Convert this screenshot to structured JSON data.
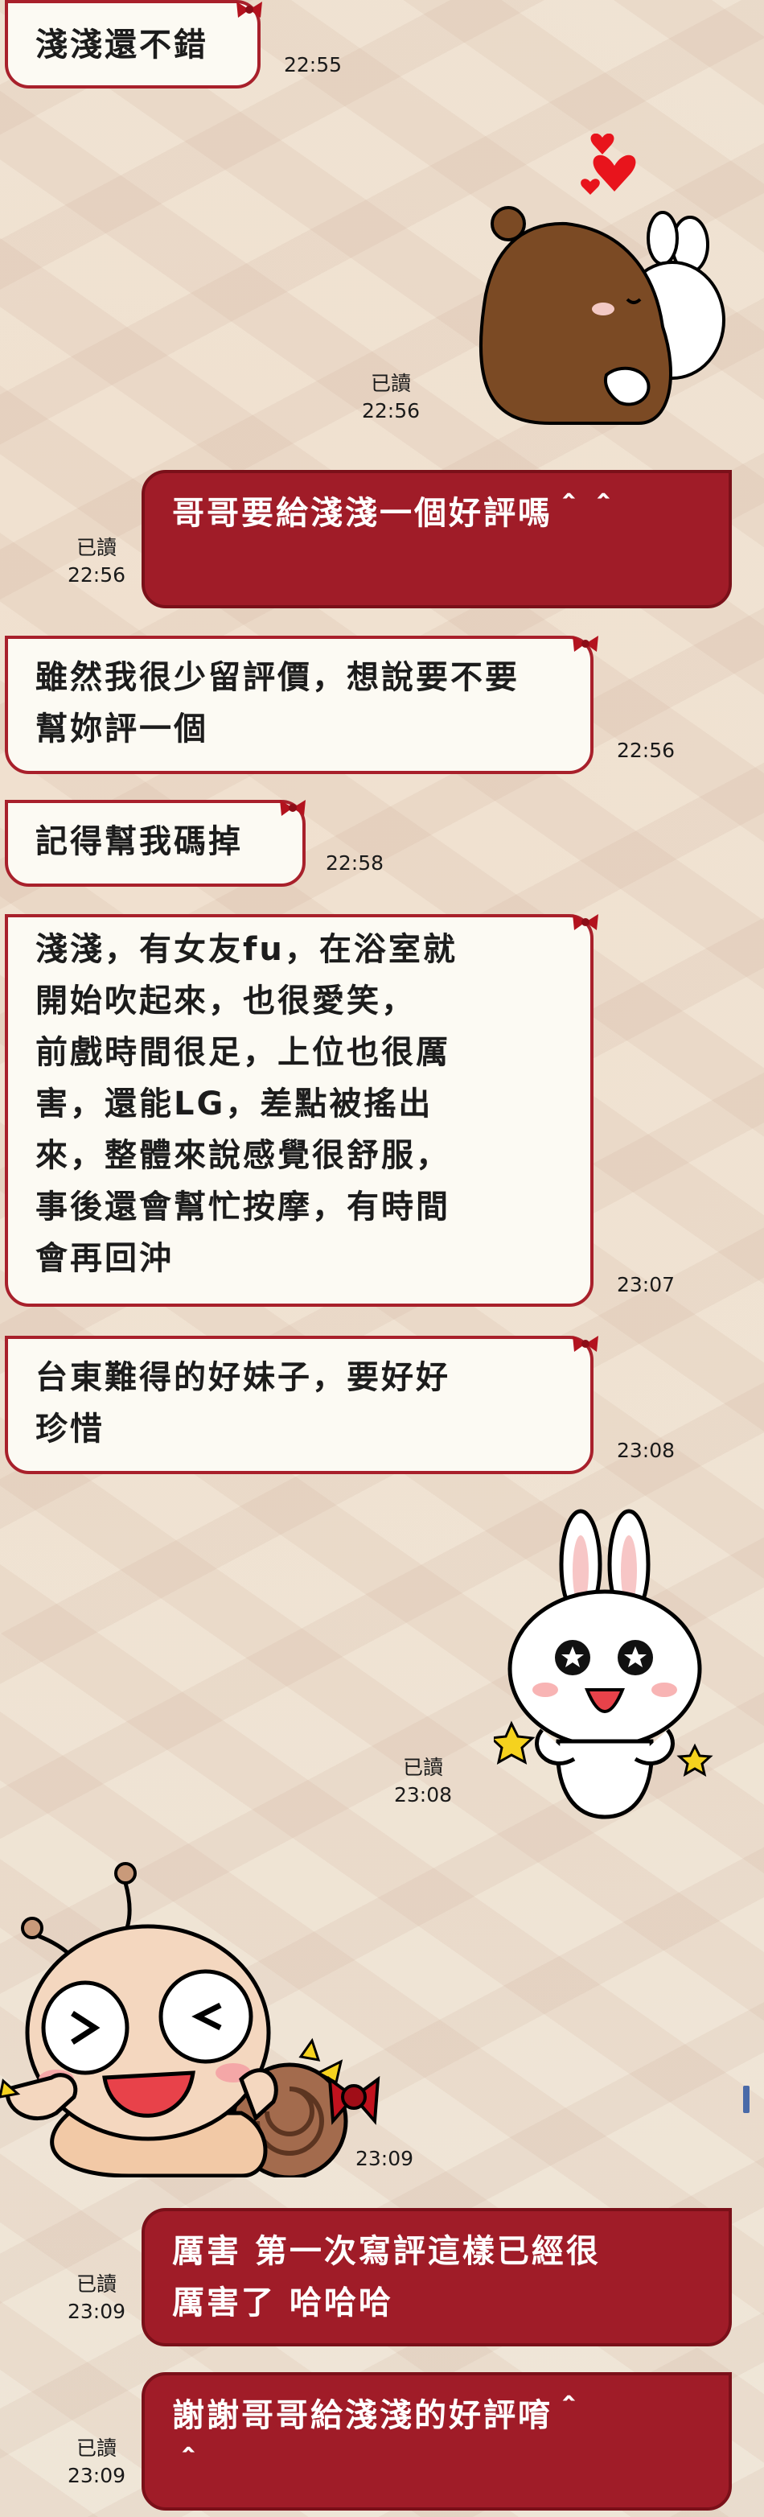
{
  "messages": [
    {
      "text": "淺淺還不錯",
      "time": "22:55"
    },
    {
      "read": "已讀",
      "time": "22:56"
    },
    {
      "text": "哥哥要給淺淺一個好評嗎＾＾",
      "read": "已讀",
      "time": "22:56"
    },
    {
      "text": "雖然我很少留評價，想說要不要幫妳評一個",
      "time": "22:56"
    },
    {
      "text": "記得幫我碼掉",
      "time": "22:58"
    },
    {
      "lines": [
        "淺淺，有女友fu，在浴室就",
        "開始吹起來，也很愛笑，",
        "前戲時間很足，上位也很厲",
        "害，還能LG，差點被搖出",
        "來，整體來說感覺很舒服，",
        "事後還會幫忙按摩，有時間",
        "會再回沖"
      ],
      "time": "23:07"
    },
    {
      "lines": [
        "台東難得的好妹子，要好好",
        "珍惜"
      ],
      "time": "23:08"
    },
    {
      "read": "已讀",
      "time": "23:08"
    },
    {
      "time": "23:09"
    },
    {
      "lines": [
        "厲害 第一次寫評這樣已經很",
        "厲害了 哈哈哈"
      ],
      "read": "已讀",
      "time": "23:09"
    },
    {
      "lines": [
        "謝謝哥哥給淺淺的好評唷＾",
        "＾"
      ],
      "read": "已讀",
      "time": "23:09"
    }
  ],
  "colors": {
    "incoming_bg": "#fcfaf3",
    "incoming_border": "#a8202b",
    "outgoing_bg": "#a01c28",
    "text_dark": "#1c1c1c",
    "text_light": "#ffffff"
  },
  "stickers": [
    "brown-hugging-cony-sticker",
    "cony-cheering-sticker",
    "snail-kid-thumbs-up-sticker"
  ]
}
